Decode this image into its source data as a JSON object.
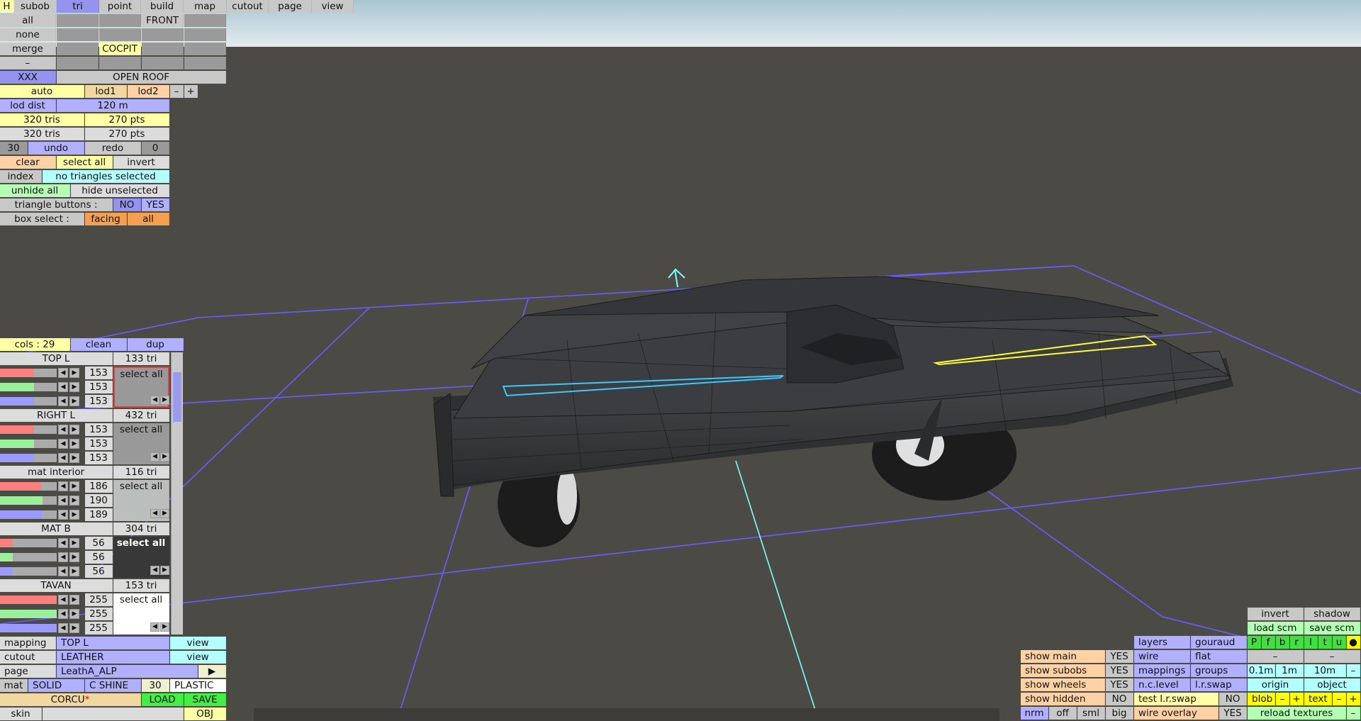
{
  "colors": {
    "bg": "#4c4a45",
    "sky_top": "#b4ccd6",
    "sky_bottom": "#dce6ea",
    "grid": "#6a5cff",
    "axis": "#78ffff",
    "sel_blue": "#3cc8ff",
    "sel_yellow": "#ffff30"
  },
  "menu": {
    "h": "H",
    "tabs": [
      "subob",
      "tri",
      "point",
      "build",
      "map",
      "cutout",
      "page",
      "view"
    ]
  },
  "subob_grid": {
    "rows": [
      "all",
      "none",
      "merge",
      "–"
    ],
    "front": "FRONT",
    "cocpit": "COCPIT"
  },
  "xxx": "XXX",
  "open_roof": "OPEN ROOF",
  "lod": {
    "auto": "auto",
    "lod1": "lod1",
    "lod2": "lod2",
    "minus": "–",
    "plus": "+",
    "dist_label": "lod dist",
    "dist_value": "120 m",
    "tris1": "320 tris",
    "pts1": "270 pts",
    "tris2": "320 tris",
    "pts2": "270 pts"
  },
  "undo": {
    "count": "30",
    "undo": "undo",
    "redo": "redo",
    "redo_count": "0"
  },
  "sel": {
    "clear": "clear",
    "select_all": "select all",
    "invert": "invert",
    "index": "index",
    "status": "no triangles selected",
    "unhide_all": "unhide all",
    "hide_unselected": "hide unselected",
    "tri_buttons": "triangle buttons :",
    "no": "NO",
    "yes": "YES",
    "box_select": "box select :",
    "facing": "facing",
    "all": "all"
  },
  "cols": {
    "label": "cols : 29",
    "clean": "clean",
    "dup": "dup"
  },
  "materials": [
    {
      "name": "TOP L",
      "tris": "133 tri",
      "r": "153",
      "g": "153",
      "b": "153",
      "select": "select all",
      "swatch": "#999999",
      "r_f": 0.6,
      "g_f": 0.6,
      "b_f": 0.6
    },
    {
      "name": "RIGHT L",
      "tris": "432 tri",
      "r": "153",
      "g": "153",
      "b": "153",
      "select": "select all",
      "swatch": "#999999",
      "r_f": 0.6,
      "g_f": 0.6,
      "b_f": 0.6
    },
    {
      "name": "mat interior",
      "tris": "116 tri",
      "r": "186",
      "g": "190",
      "b": "189",
      "select": "select all",
      "swatch": "#babebd",
      "r_f": 0.73,
      "g_f": 0.75,
      "b_f": 0.74
    },
    {
      "name": "MAT B",
      "tris": "304 tri",
      "r": "56",
      "g": "56",
      "b": "56",
      "select": "select all",
      "swatch": "#383838",
      "r_f": 0.22,
      "g_f": 0.22,
      "b_f": 0.22
    },
    {
      "name": "TAVAN",
      "tris": "153 tri",
      "r": "255",
      "g": "255",
      "b": "255",
      "select": "select all",
      "swatch": "#ffffff",
      "r_f": 1,
      "g_f": 1,
      "b_f": 1
    }
  ],
  "props": {
    "mapping": "mapping",
    "mapping_val": "TOP L",
    "view": "view",
    "cutout": "cutout",
    "cutout_val": "LEATHER",
    "page": "page",
    "page_val": "LeathA_ALP",
    "mat": "mat",
    "solid": "SOLID",
    "cshine": "C SHINE",
    "shine_val": "30",
    "plastic": "PLASTIC",
    "file": "CORCU",
    "asterisk": "*",
    "load": "LOAD",
    "save": "SAVE",
    "skin": "skin",
    "obj": "OBJ"
  },
  "right": {
    "invert": "invert",
    "shadow": "shadow",
    "load_scm": "load scm",
    "save_scm": "save scm",
    "layers": "layers",
    "gouraud": "gouraud",
    "flat": "flat",
    "wire": "wire",
    "mappings": "mappings",
    "groups": "groups",
    "nclevel": "n.c.level",
    "lrswap": "l.r.swap",
    "test_lrswap": "test l.r.swap",
    "no": "NO",
    "wire_overlay": "wire overlay",
    "yes": "YES",
    "toggles": [
      "P",
      "f",
      "b",
      "r",
      "l",
      "t",
      "u",
      "●"
    ],
    "dash": "–",
    "d01": "0.1m",
    "d1": "1m",
    "d10": "10m",
    "origin": "origin",
    "object": "object",
    "blob": "blob",
    "minus": "–",
    "plus": "+",
    "text": "text",
    "reload": "reload textures"
  },
  "shows": [
    {
      "label": "show main",
      "val": "YES"
    },
    {
      "label": "show subobs",
      "val": "YES"
    },
    {
      "label": "show wheels",
      "val": "YES"
    },
    {
      "label": "show hidden",
      "val": "NO"
    }
  ],
  "view_btns": [
    "nrm",
    "off",
    "sml",
    "big"
  ]
}
